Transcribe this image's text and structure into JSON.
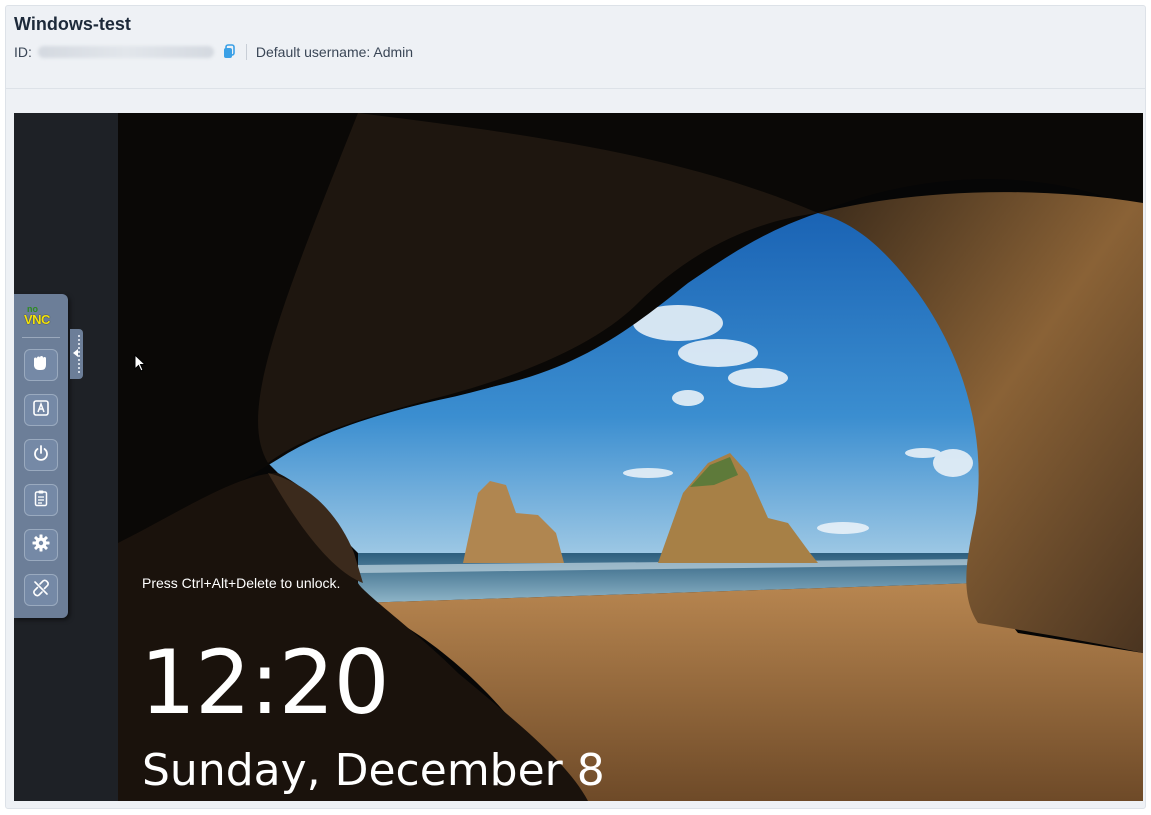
{
  "header": {
    "title": "Windows-test",
    "id_label": "ID:",
    "id_value": "••••••••••••••••••••",
    "username_text": "Default username: Admin"
  },
  "novnc": {
    "logo_top": "no",
    "logo_bottom": "VNC",
    "buttons": [
      {
        "icon": "hand-icon",
        "name": "drag-viewport-button"
      },
      {
        "icon": "keyboard-icon",
        "name": "show-keyboard-button"
      },
      {
        "icon": "power-icon",
        "name": "power-button"
      },
      {
        "icon": "clipboard-icon",
        "name": "clipboard-button"
      },
      {
        "icon": "gear-icon",
        "name": "settings-button"
      },
      {
        "icon": "disconnect-icon",
        "name": "disconnect-button"
      }
    ]
  },
  "lockscreen": {
    "message": "Press Ctrl+Alt+Delete to unlock.",
    "time": "12:20",
    "date": "Sunday, December 8"
  },
  "colors": {
    "accent": "#3aa0e6",
    "toolbar": "#6c7e98",
    "title": "#1d2a3a"
  }
}
